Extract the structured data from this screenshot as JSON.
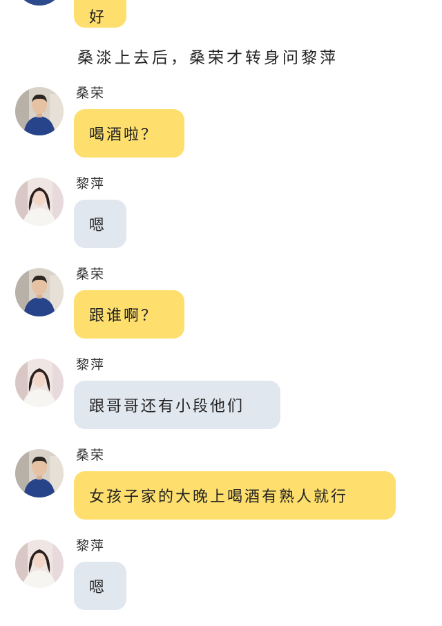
{
  "narration": "桑渁上去后，桑荣才转身问黎萍",
  "messages": [
    {
      "sender": "",
      "avatar": "male-avatar",
      "text": "好",
      "color": "yellow"
    },
    {
      "sender": "桑荣",
      "avatar": "male-avatar",
      "text": "喝酒啦？",
      "color": "yellow"
    },
    {
      "sender": "黎萍",
      "avatar": "female-avatar",
      "text": "嗯",
      "color": "gray"
    },
    {
      "sender": "桑荣",
      "avatar": "male-avatar",
      "text": "跟谁啊？",
      "color": "yellow"
    },
    {
      "sender": "黎萍",
      "avatar": "female-avatar",
      "text": "跟哥哥还有小段他们",
      "color": "gray"
    },
    {
      "sender": "桑荣",
      "avatar": "male-avatar",
      "text": "女孩子家的大晚上喝酒有熟人就行",
      "color": "yellow"
    },
    {
      "sender": "黎萍",
      "avatar": "female-avatar",
      "text": "嗯",
      "color": "gray"
    }
  ],
  "colors": {
    "yellow_bubble": "#fedf6e",
    "gray_bubble": "#e1e7ef"
  }
}
